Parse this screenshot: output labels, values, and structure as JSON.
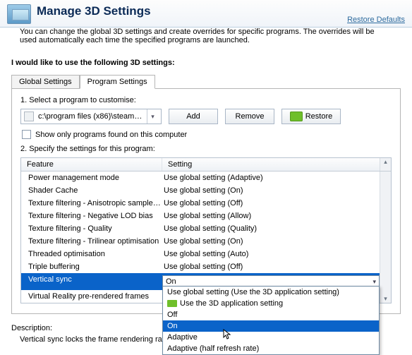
{
  "header": {
    "title": "Manage 3D Settings",
    "restore_link": "Restore Defaults"
  },
  "intro": "You can change the global 3D settings and create overrides for specific programs. The overrides will be used automatically each time the specified programs are launched.",
  "section_title": "I would like to use the following 3D settings:",
  "tabs": {
    "global": "Global Settings",
    "program": "Program Settings"
  },
  "step1": {
    "label": "1. Select a program to customise:",
    "program_path": "c:\\program files (x86)\\steam\\st...",
    "add": "Add",
    "remove": "Remove",
    "restore": "Restore",
    "show_only": "Show only programs found on this computer"
  },
  "step2": {
    "label": "2. Specify the settings for this program:"
  },
  "table": {
    "head_feature": "Feature",
    "head_setting": "Setting",
    "rows": [
      {
        "feature": "Power management mode",
        "setting": "Use global setting (Adaptive)"
      },
      {
        "feature": "Shader Cache",
        "setting": "Use global setting (On)"
      },
      {
        "feature": "Texture filtering - Anisotropic sample opti...",
        "setting": "Use global setting (Off)"
      },
      {
        "feature": "Texture filtering - Negative LOD bias",
        "setting": "Use global setting (Allow)"
      },
      {
        "feature": "Texture filtering - Quality",
        "setting": "Use global setting (Quality)"
      },
      {
        "feature": "Texture filtering - Trilinear optimisation",
        "setting": "Use global setting (On)"
      },
      {
        "feature": "Threaded optimisation",
        "setting": "Use global setting (Auto)"
      },
      {
        "feature": "Triple buffering",
        "setting": "Use global setting (Off)"
      },
      {
        "feature": "Vertical sync",
        "setting": "On",
        "selected": true
      },
      {
        "feature": "Virtual Reality pre-rendered frames",
        "setting": ""
      }
    ]
  },
  "dropdown": {
    "items": [
      {
        "label": "Use global setting (Use the 3D application setting)"
      },
      {
        "label": "Use the 3D application setting",
        "nv": true
      },
      {
        "label": "Off"
      },
      {
        "label": "On",
        "hl": true
      },
      {
        "label": "Adaptive"
      },
      {
        "label": "Adaptive (half refresh rate)"
      }
    ]
  },
  "description": {
    "label": "Description:",
    "text": "Vertical sync locks the frame rendering rate to the m"
  }
}
